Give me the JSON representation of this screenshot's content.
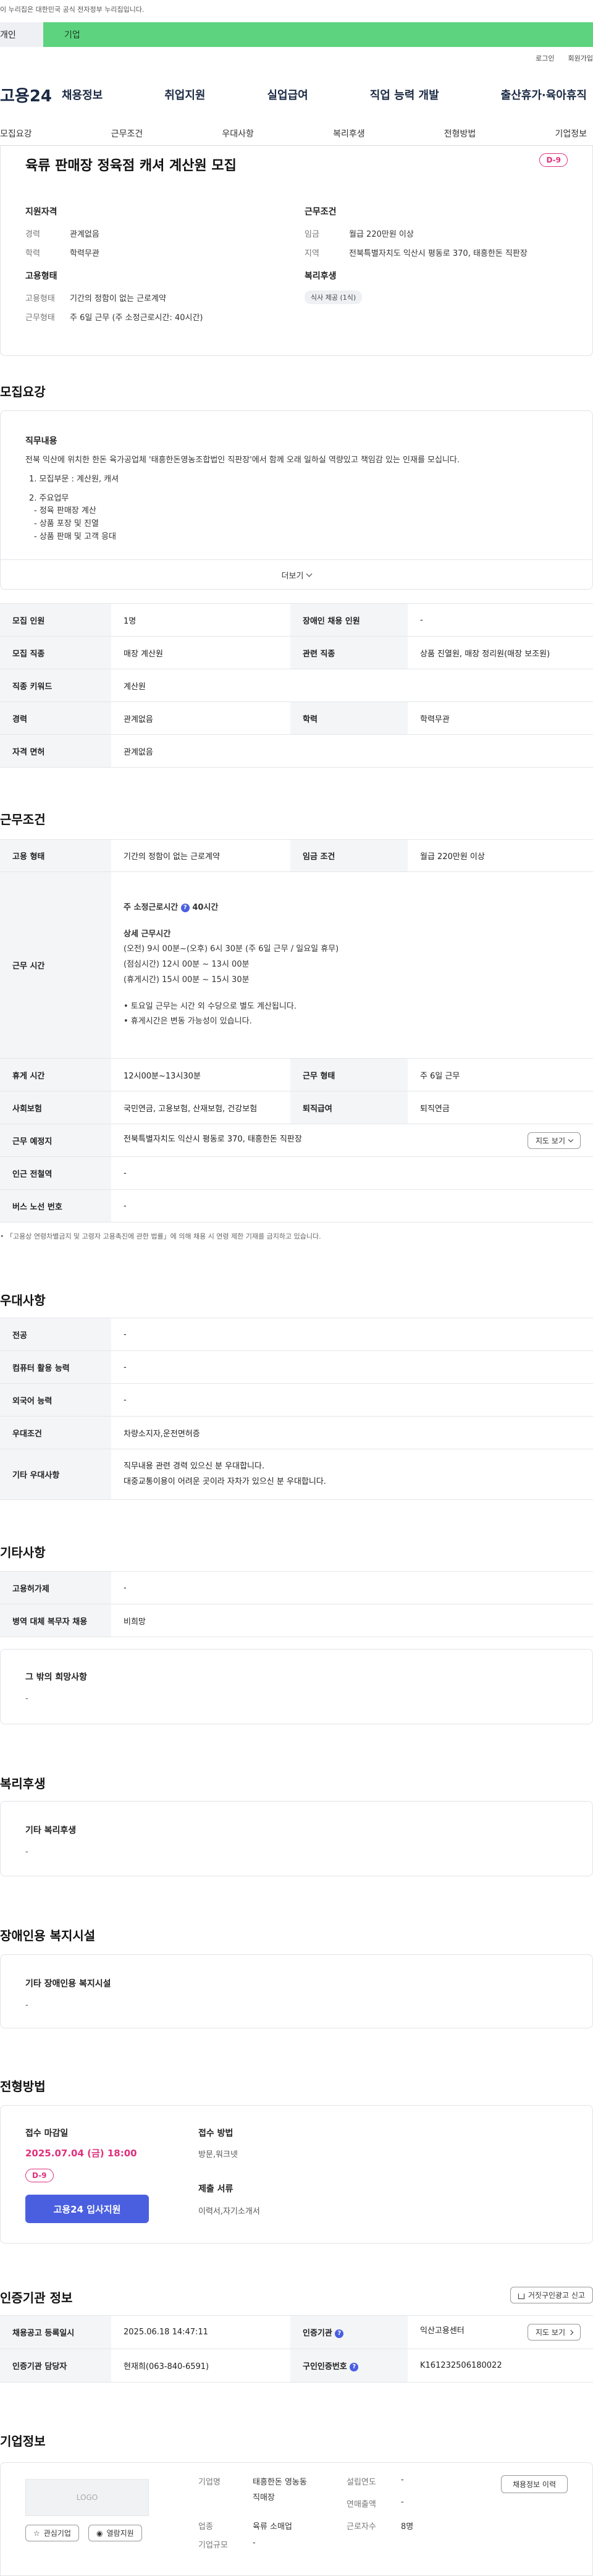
{
  "top": {
    "gov_notice": "이 누리집은 대한민국 공식 전자정부 누리집입니다.",
    "seg_personal": "개인",
    "seg_company": "기업",
    "login": "로그인",
    "signup": "회원가입"
  },
  "gnb": {
    "logo": "고용24",
    "menu": [
      "채용정보",
      "취업지원",
      "실업급여",
      "직업 능력 개발",
      "출산휴가·육아휴직"
    ]
  },
  "subnav": [
    "모집요강",
    "근무조건",
    "우대사항",
    "복리후생",
    "전형방법",
    "기업정보"
  ],
  "summary": {
    "title": "육류 판매장 정육점 캐셔 계산원 모집",
    "dday": "D-9",
    "qual_head": "지원자격",
    "qual": [
      {
        "k": "경력",
        "v": "관계없음"
      },
      {
        "k": "학력",
        "v": "학력무관"
      }
    ],
    "cond_head": "근무조건",
    "cond": [
      {
        "k": "임금",
        "v": "월급 220만원 이상"
      },
      {
        "k": "지역",
        "v": "전북특별자치도 익산시 평동로 370, 태흥한돈 직판장"
      }
    ],
    "emp_head": "고용형태",
    "emp": [
      {
        "k": "고용형태",
        "v": "기간의 정함이 없는 근로계약"
      },
      {
        "k": "근무형태",
        "v": "주 6일 근무 (주 소정근로시간: 40시간)"
      }
    ],
    "welfare_head": "복리후생",
    "welfare_pill": "식사 제공 (1식)"
  },
  "recruit": {
    "title": "모집요강",
    "job_head": "직무내용",
    "job_intro": "전북 익산에 위치한 한돈 육가공업체 '태흥한돈영농조합법인 직판장'에서 함께 오래 일하실 역량있고 책임감 있는 인재를 모십니다.",
    "job_1": "1. 모집부문 : 계산원, 캐셔",
    "job_2": "2. 주요업무",
    "job_2a": "- 정육 판매장 계산",
    "job_2b": "- 상품 포장 및 진열",
    "job_2c": "- 상품 판매 및 고객 응대",
    "more": "더보기",
    "rows": {
      "count_k": "모집 인원",
      "count_v": "1명",
      "disabled_k": "장애인 채용 인원",
      "disabled_v": "-",
      "job_k": "모집 직종",
      "job_v": "매장 계산원",
      "rel_k": "관련 직종",
      "rel_v": "상품 진열원, 매장 정리원(매장 보조원)",
      "kw_k": "직종 키워드",
      "kw_v": "계산원",
      "career_k": "경력",
      "career_v": "관계없음",
      "edu_k": "학력",
      "edu_v": "학력무관",
      "lic_k": "자격 면허",
      "lic_v": "관계없음"
    }
  },
  "work": {
    "title": "근무조건",
    "emp_k": "고용 형태",
    "emp_v": "기간의 정함이 없는 근로계약",
    "wage_k": "임금 조건",
    "wage_v": "월급 220만원 이상",
    "time_k": "근무 시간",
    "time_weekly_label": "주 소정근로시간",
    "time_weekly_value": "40시간",
    "time_detail_head": "상세 근무시간",
    "time_l1": "(오전) 9시 00분~(오후) 6시 30분 (주 6일 근무 / 일요일 휴무)",
    "time_l2": "(점심시간) 12시 00분 ~ 13시 00분",
    "time_l3": "(휴게시간) 15시 00분 ~ 15시 30분",
    "time_l4": "• 토요일 근무는 시간 외 수당으로 별도 계산됩니다.",
    "time_l5": "• 휴게시간은 변동 가능성이 있습니다.",
    "rest_k": "휴게 시간",
    "rest_v": "12시00분~13시30분",
    "form_k": "근무 형태",
    "form_v": "주 6일 근무",
    "ins_k": "사회보험",
    "ins_v": "국민연금, 고용보험, 산재보험, 건강보험",
    "ret_k": "퇴직급여",
    "ret_v": "퇴직연금",
    "place_k": "근무 예정지",
    "place_v": "전북특별자치도 익산시 평동로 370, 태흥한돈 직판장",
    "map_btn": "지도 보기",
    "subway_k": "인근 전철역",
    "subway_v": "-",
    "bus_k": "버스 노선 번호",
    "bus_v": "-",
    "note": "• 「고용상 연령차별금지 및 고령자 고용촉진에 관한 법률」에 의해 채용 시 연령 제한 기재를 금지하고 있습니다."
  },
  "pref": {
    "title": "우대사항",
    "major_k": "전공",
    "major_v": "-",
    "pc_k": "컴퓨터 활용 능력",
    "pc_v": "-",
    "lang_k": "외국어 능력",
    "lang_v": "-",
    "cond_k": "우대조건",
    "cond_v": "차량소지자,운전면허증",
    "etc_k": "기타 우대사항",
    "etc_v1": "직무내용 관련 경력 있으신 분 우대합니다.",
    "etc_v2": "대중교통이용이 어려운 곳이라 자차가 있으신 분 우대합니다."
  },
  "etc": {
    "title": "기타사항",
    "hire_k": "고용허가제",
    "hire_v": "-",
    "mil_k": "병역 대체 복무자 채용",
    "mil_v": "비희망",
    "wish_head": "그 밖의 희망사항",
    "wish_v": "-"
  },
  "welfare": {
    "title": "복리후생",
    "head": "기타 복리후생",
    "v": "-"
  },
  "disab": {
    "title": "장애인용 복지시설",
    "head": "기타 장애인용 복지시설",
    "v": "-"
  },
  "process": {
    "title": "전형방법",
    "deadline_head": "접수 마감일",
    "deadline_v": "2025.07.04 (금) 18:00",
    "dday": "D-9",
    "apply_btn": "고용24 입사지원",
    "method_head": "접수 방법",
    "method_v": "방문,워크넷",
    "doc_head": "제출 서류",
    "doc_v": "이력서,자기소개서"
  },
  "cert": {
    "title": "인증기관 정보",
    "report_btn": "거짓구인광고 신고",
    "reg_k": "채용공고 등록일시",
    "reg_v": "2025.06.18 14:47:11",
    "org_k": "인증기관",
    "org_v": "익산고용센터",
    "map_btn": "지도 보기",
    "mgr_k": "인증기관 담당자",
    "mgr_v": "현재희(063-840-6591)",
    "num_k": "구인인증번호",
    "num_v": "K161232506180022"
  },
  "company": {
    "title": "기업정보",
    "logo": "LOGO",
    "fav_btn": "관심기업",
    "job_btn": "열람지원",
    "history_btn": "채용정보 이력",
    "name_k": "기업명",
    "name_v1": "태흥한돈 영농동",
    "name_v2": "직매장",
    "year_k": "설립연도",
    "year_v": "-",
    "sales_k": "연매출액",
    "sales_v": "-",
    "ind_k": "업종",
    "ind_v": "육류 소매업",
    "emp_k": "근로자수",
    "emp_v": "8명",
    "size_k": "기업규모",
    "size_v": "-"
  }
}
